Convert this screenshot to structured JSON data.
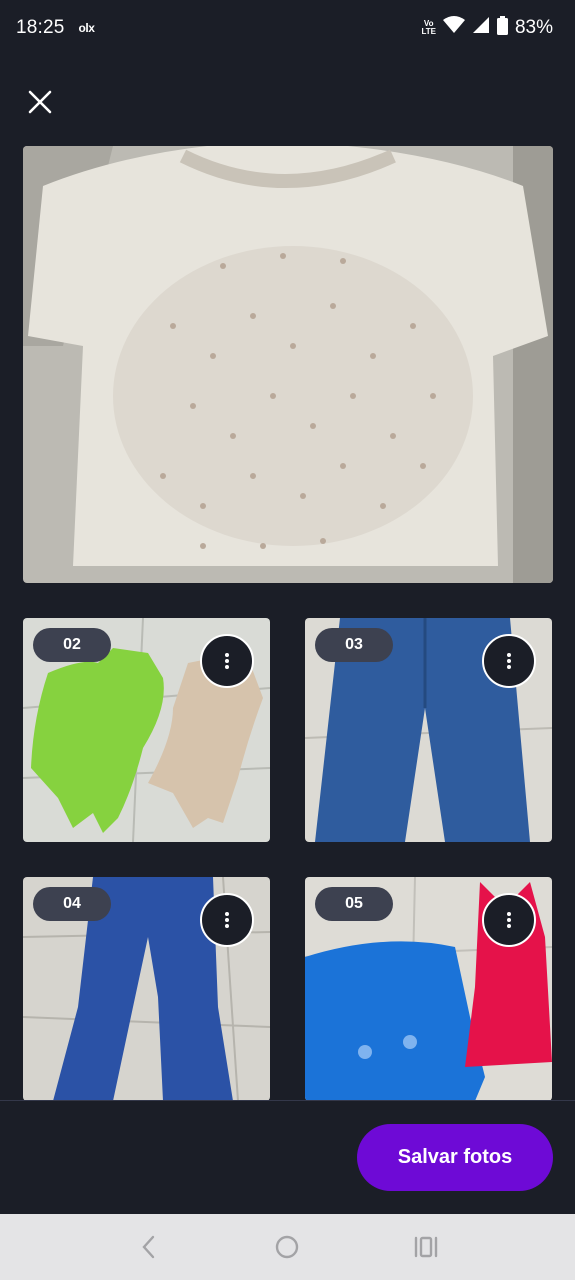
{
  "status_bar": {
    "time": "18:25",
    "app_notification": "olx",
    "network": "Vo LTE",
    "battery": "83%"
  },
  "icons": {
    "close": "close-icon",
    "more": "more-vert-icon",
    "back": "back-icon",
    "home": "home-icon",
    "recents": "recents-icon"
  },
  "photos": {
    "main": {
      "description_icon": "photo-white-blouse"
    },
    "thumbs": [
      {
        "number": "02"
      },
      {
        "number": "03"
      },
      {
        "number": "04"
      },
      {
        "number": "05"
      }
    ]
  },
  "actions": {
    "save_label": "Salvar fotos"
  },
  "colors": {
    "background": "#1b1e27",
    "primary_button": "#6e0ad6",
    "badge": "#3d4150",
    "nav_bar": "#e4e4e6"
  }
}
